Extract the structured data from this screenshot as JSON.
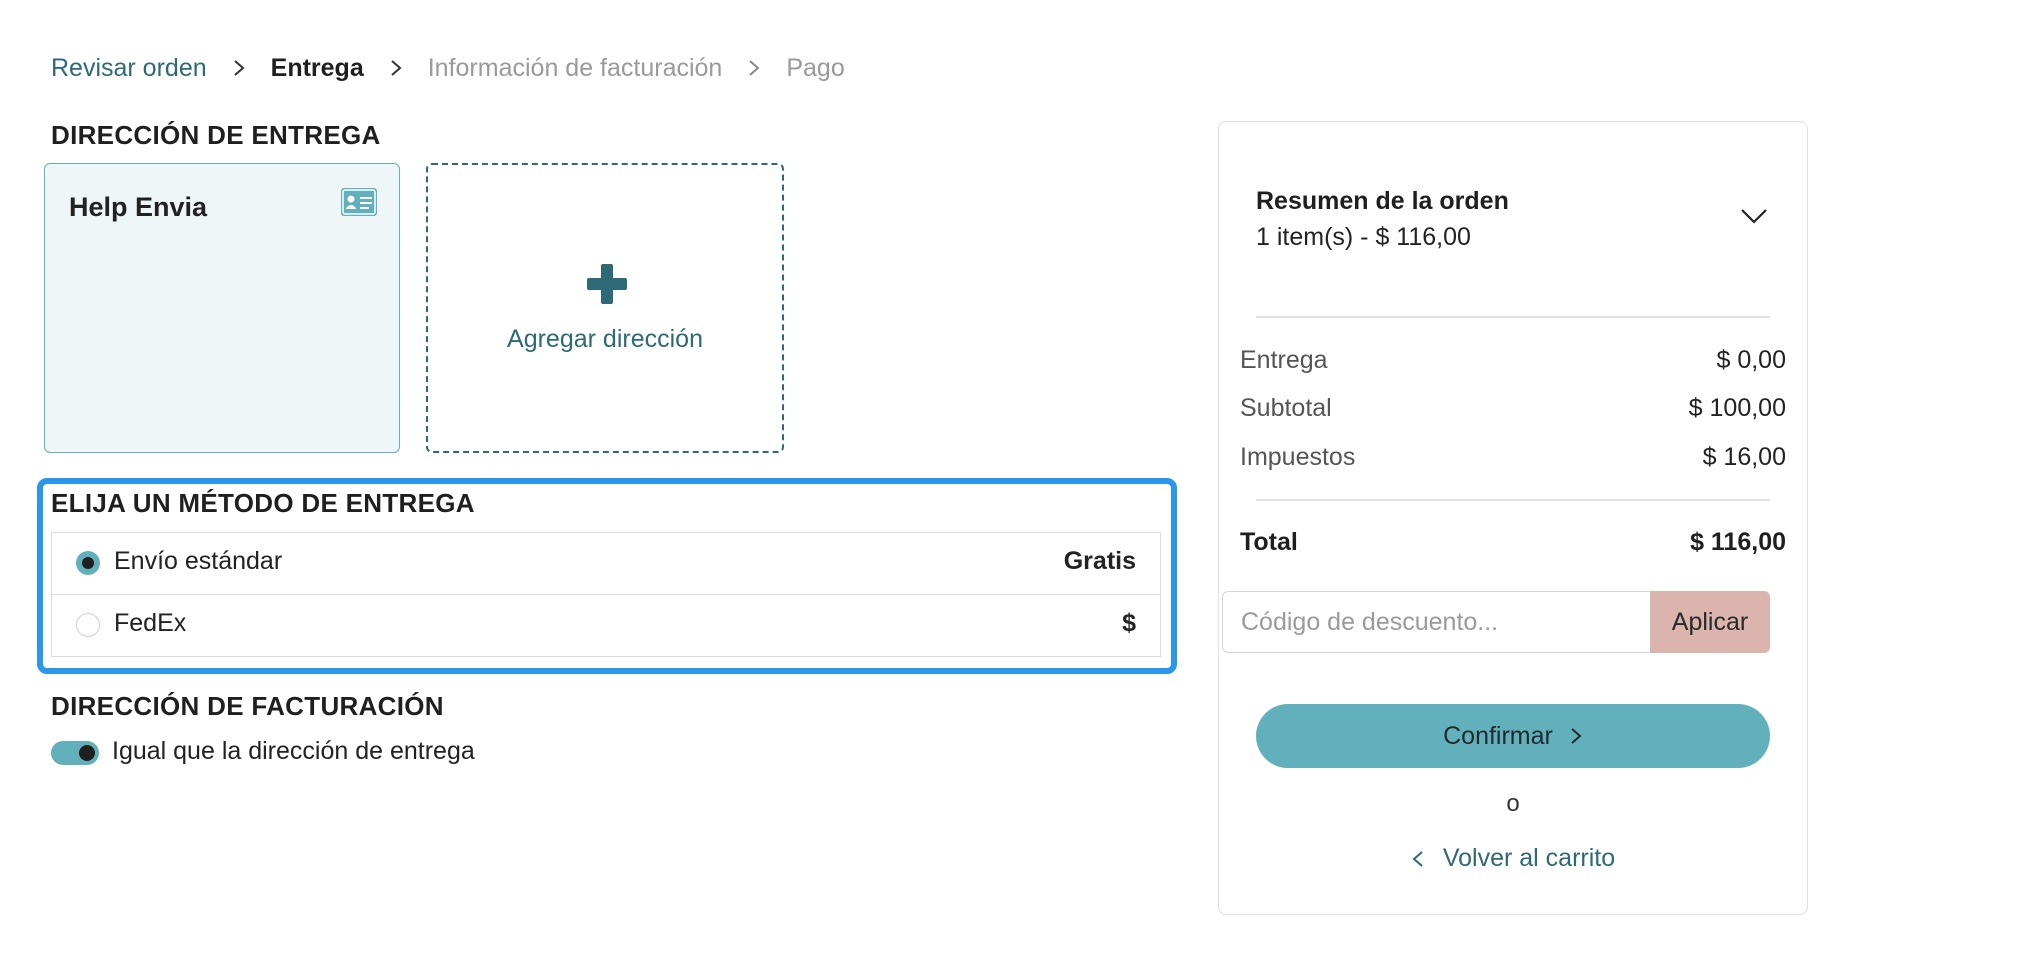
{
  "breadcrumb": {
    "steps": [
      {
        "label": "Revisar orden",
        "state": "done"
      },
      {
        "label": "Entrega",
        "state": "current"
      },
      {
        "label": "Información de facturación",
        "state": "todo"
      },
      {
        "label": "Pago",
        "state": "todo"
      }
    ]
  },
  "delivery_address": {
    "title": "DIRECCIÓN DE ENTREGA",
    "selected_card": {
      "name": "Help Envia",
      "icon": "id-card-icon"
    },
    "add_card": {
      "label": "Agregar dirección",
      "icon": "plus-icon"
    }
  },
  "delivery_method": {
    "title": "ELIJA UN MÉTODO DE ENTREGA",
    "options": [
      {
        "label": "Envío estándar",
        "price": "Gratis",
        "selected": true
      },
      {
        "label": "FedEx",
        "price": "$",
        "selected": false
      }
    ]
  },
  "billing": {
    "title": "DIRECCIÓN DE FACTURACIÓN",
    "same_as_shipping_label": "Igual que la dirección de entrega",
    "same_as_shipping": true
  },
  "summary": {
    "title": "Resumen de la orden",
    "items_line": "1 item(s) -  $ 116,00",
    "lines": [
      {
        "label": "Entrega",
        "value": "$ 0,00"
      },
      {
        "label": "Subtotal",
        "value": "$ 100,00"
      },
      {
        "label": "Impuestos",
        "value": "$ 16,00"
      }
    ],
    "total_label": "Total",
    "total_value": "$ 116,00",
    "discount_placeholder": "Código de descuento...",
    "discount_value": "",
    "apply_label": "Aplicar",
    "confirm_label": "Confirmar",
    "or_text": "o",
    "back_label": "Volver al carrito"
  },
  "colors": {
    "accent": "#63b0bd",
    "link": "#2d6a75",
    "highlight_frame": "#2b96ea",
    "apply_button": "#dbb4ad",
    "selected_card_bg": "#eef6f7"
  }
}
